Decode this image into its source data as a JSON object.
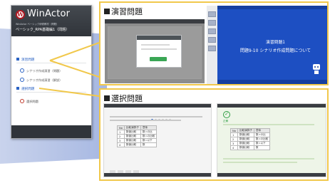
{
  "app": {
    "logo_mark": "W",
    "logo_text": "WinActor",
    "header_sub": "WinActor ベーシック研修教材（問題）",
    "header_title": "ベーシック_RPA基礎編1（問題）"
  },
  "sidebar": {
    "sections": [
      {
        "label": "演習問題",
        "items": [
          "シナリオ作成演習（問題）",
          "シナリオ作成演習（解説）"
        ]
      },
      {
        "label": "選択問題",
        "items": [
          "選択問題"
        ]
      }
    ]
  },
  "cards": [
    {
      "title": "演習問題",
      "slide": {
        "title": "演習問題1",
        "subtitle": "問題9-10 シナリオ作成問題について"
      }
    },
    {
      "title": "選択問題",
      "table_headers": [
        "No",
        "比較演算子",
        "意味"
      ],
      "table_rows": [
        [
          "1",
          "数値比較",
          "数=の比"
        ],
        [
          "2",
          "数値比較",
          "数=の比較"
        ],
        [
          "3",
          "数値比較",
          "数=以下"
        ],
        [
          "4",
          "数値比較",
          "数"
        ]
      ],
      "answer_label": "正解"
    }
  ],
  "colors": {
    "accent": "#2b63c4",
    "frame": "#f1c84b",
    "slide_bg": "#1d4fc2",
    "header_bg": "#30343a",
    "brand_red": "#b01a23"
  },
  "icons": [
    "winactor-logo-icon",
    "document-icon",
    "pencil-icon",
    "check-circle-icon",
    "robot-icon"
  ]
}
